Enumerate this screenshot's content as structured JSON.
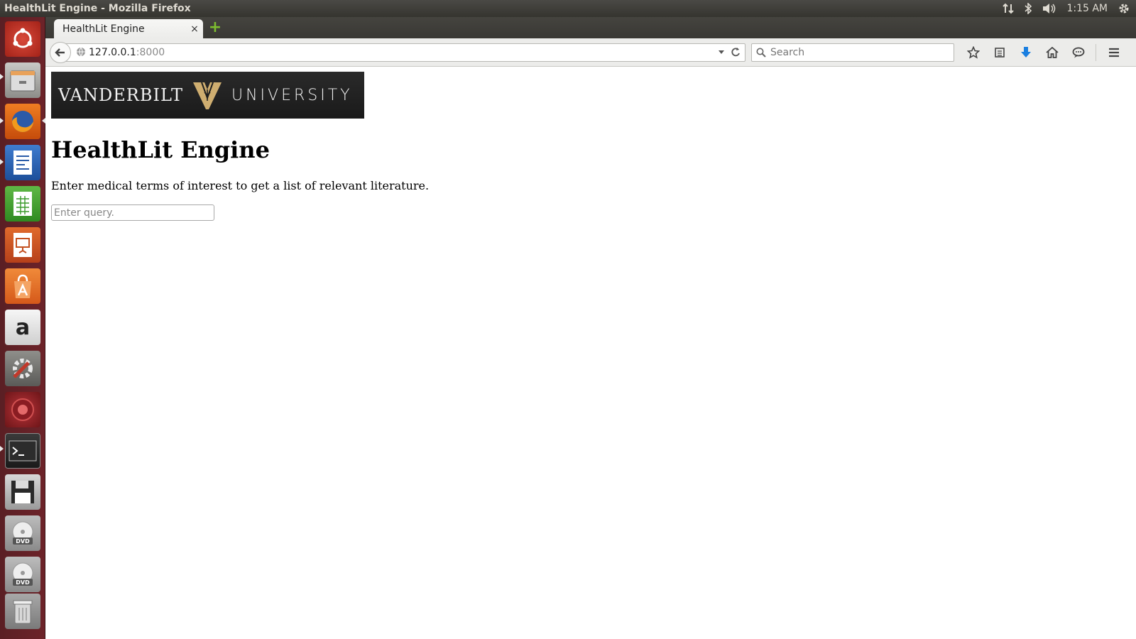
{
  "os_panel": {
    "window_title": "HealthLit Engine - Mozilla Firefox",
    "clock": "1:15 AM",
    "indicators": [
      "network-icon",
      "bluetooth-icon",
      "volume-icon",
      "settings-gear-icon"
    ]
  },
  "launcher": {
    "items": [
      {
        "name": "ubuntu-dash-icon"
      },
      {
        "name": "files-icon"
      },
      {
        "name": "firefox-icon"
      },
      {
        "name": "writer-icon"
      },
      {
        "name": "calc-icon"
      },
      {
        "name": "impress-icon"
      },
      {
        "name": "software-center-icon"
      },
      {
        "name": "amazon-icon"
      },
      {
        "name": "system-settings-icon"
      },
      {
        "name": "app-icon"
      },
      {
        "name": "terminal-icon"
      },
      {
        "name": "floppy-drive-icon"
      },
      {
        "name": "dvd-drive-icon"
      },
      {
        "name": "dvd-drive-icon"
      },
      {
        "name": "trash-icon"
      }
    ],
    "amazon_glyph": "a"
  },
  "browser": {
    "tab_title": "HealthLit Engine",
    "tab_close": "×",
    "new_tab": "+",
    "url_host": "127.0.0.1",
    "url_port": ":8000",
    "search_placeholder": "Search"
  },
  "page": {
    "logo_left": "VANDERBILT",
    "logo_right": "UNIVERSITY",
    "title": "HealthLit Engine",
    "description": "Enter medical terms of interest to get a list of relevant literature.",
    "query_placeholder": "Enter query."
  },
  "colors": {
    "launcher_bg": "#6d2329",
    "logo_gold": "#cfae70",
    "accent_blue": "#1a7fe0"
  }
}
